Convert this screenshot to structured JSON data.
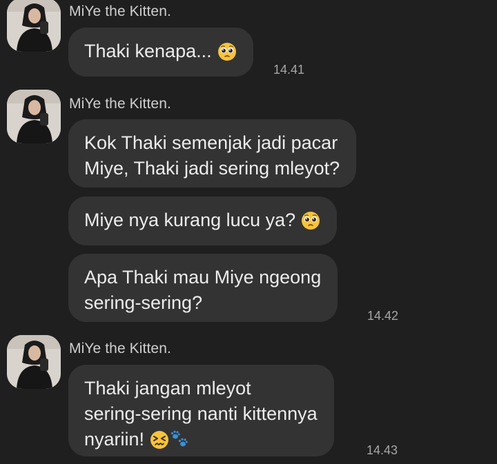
{
  "chat": {
    "groups": [
      {
        "sender": "MiYe the Kitten.",
        "messages": [
          {
            "lines": [
              "Thaki kenapa..."
            ],
            "emoji": "pleading-face-icon"
          }
        ],
        "time": "14.41"
      },
      {
        "sender": "MiYe the Kitten.",
        "messages": [
          {
            "lines": [
              "Kok Thaki semenjak jadi pacar",
              "Miye, Thaki jadi sering mleyot?"
            ]
          },
          {
            "lines": [
              "Miye nya kurang lucu ya?"
            ],
            "emoji": "pleading-face-icon"
          },
          {
            "lines": [
              "Apa Thaki mau Miye ngeong",
              "sering-sering?"
            ]
          }
        ],
        "time": "14.42"
      },
      {
        "sender": "MiYe the Kitten.",
        "messages": [
          {
            "lines": [
              "Thaki jangan mleyot",
              "sering-sering nanti kittennya",
              "nyariin!"
            ],
            "emoji": "confounded-face-icon, paw-prints-icon"
          }
        ],
        "time": "14.43"
      }
    ]
  },
  "colors": {
    "background": "#1f1f1f",
    "bubble": "#333333",
    "text": "#ececec",
    "sender": "#cfcfcf",
    "time": "#a7a7a7",
    "emoji_yellow": "#f7c33c",
    "paw_blue": "#3d8fd6"
  }
}
